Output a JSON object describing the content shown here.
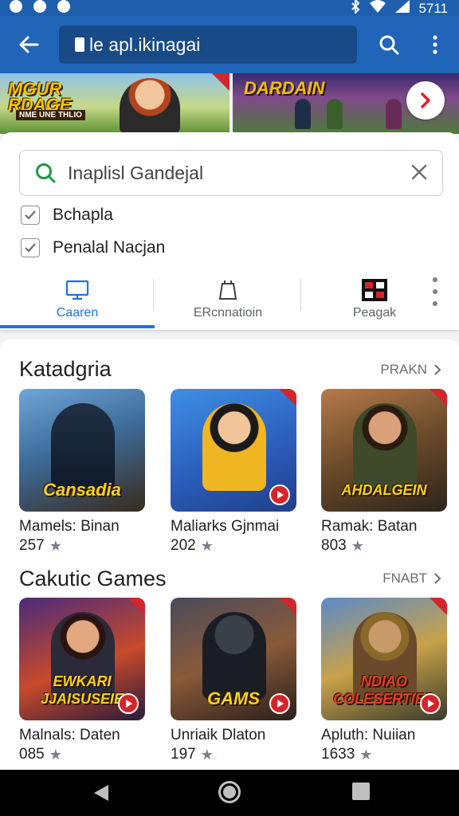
{
  "status_bar": {
    "time": "5711"
  },
  "app_bar": {
    "url": "le apl.ikinagai"
  },
  "banner": {
    "left_title": "MGUR RDAGE",
    "left_subtitle": "NME UNE THLIO",
    "right_title": "DARDAIN"
  },
  "search": {
    "value": "Inaplisl Gandejal"
  },
  "filters": [
    {
      "label": "Bchapla",
      "checked": true
    },
    {
      "label": "Penalal Nacjan",
      "checked": true
    }
  ],
  "tabs": [
    {
      "label": "Caaren",
      "active": true
    },
    {
      "label": "ERcnnatioin",
      "active": false
    },
    {
      "label": "Peagak",
      "active": false
    }
  ],
  "sections": [
    {
      "title": "Katadgria",
      "more_label": "PRAKN",
      "items": [
        {
          "caption": "Cansadia",
          "name": "Mamels: Binan",
          "rating": "257"
        },
        {
          "caption": "",
          "name": "Maliarks Gjnmai",
          "rating": "202"
        },
        {
          "caption": "AHDALGEIN",
          "name": "Ramak: Batan",
          "rating": "803"
        }
      ]
    },
    {
      "title": "Cakutic Games",
      "more_label": "FNABT",
      "items": [
        {
          "caption": "EWKARI JJAISUSEIE",
          "name": "Malnals: Daten",
          "rating": "085"
        },
        {
          "caption": "GAMS",
          "name": "Unriaik Dlaton",
          "rating": "197"
        },
        {
          "caption": "NDIAO COLESERTIER",
          "name": "Apluth: Nuiian",
          "rating": "1633"
        }
      ]
    }
  ],
  "colors": {
    "primary": "#2165b8",
    "accent": "#1a73e8",
    "badge_red": "#d8232a"
  }
}
